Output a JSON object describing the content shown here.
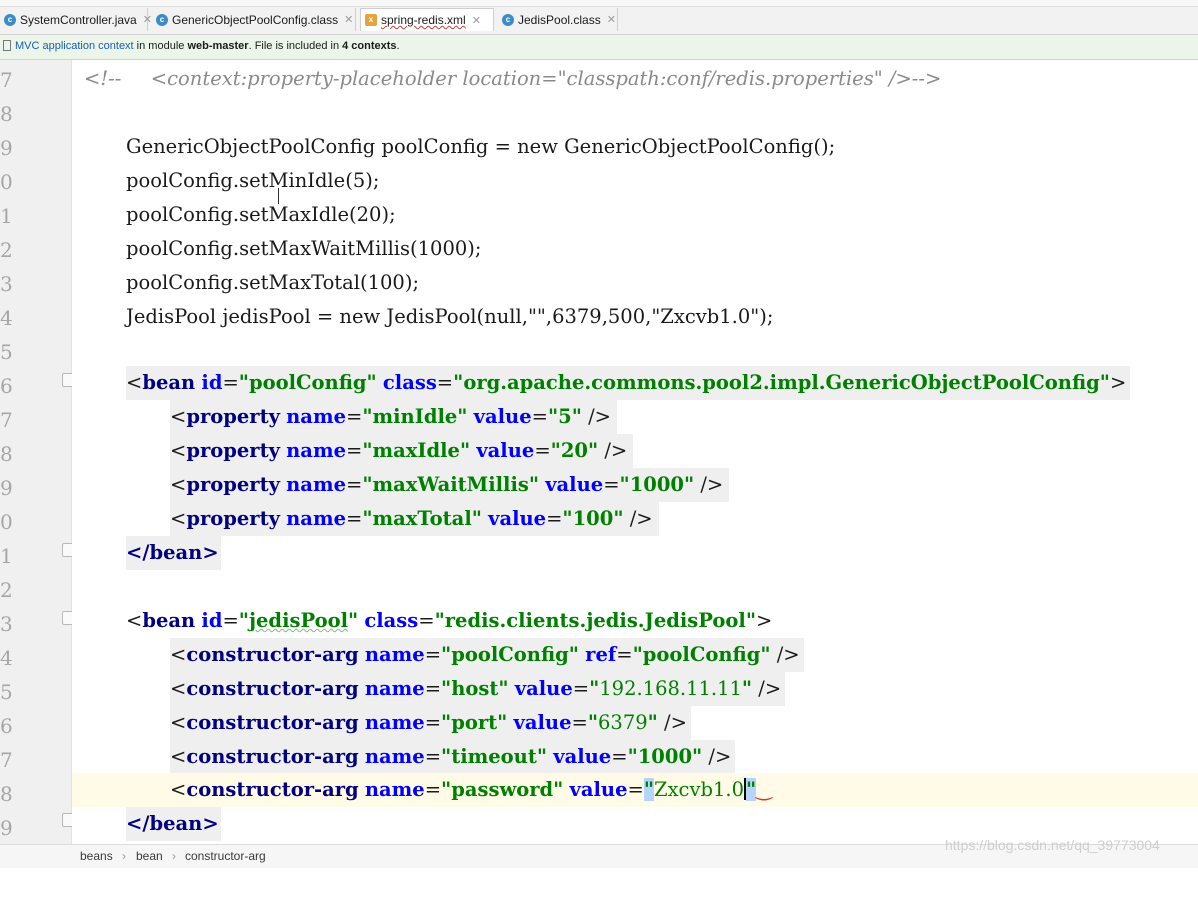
{
  "tabs": [
    {
      "label": "SystemController.java",
      "icon": "java-class-icon",
      "active": false
    },
    {
      "label": "GenericObjectPoolConfig.class",
      "icon": "class-file-icon",
      "active": false
    },
    {
      "label": "spring-redis.xml",
      "icon": "xml-file-icon",
      "active": true
    },
    {
      "label": "JedisPool.class",
      "icon": "class-file-icon",
      "active": false
    }
  ],
  "infobar": {
    "link": "MVC application context",
    "text1": " in module ",
    "module": "web-master",
    "text2": ". File is included in ",
    "contexts": "4 contexts",
    "text3": "."
  },
  "line_numbers": [
    "7",
    "8",
    "9",
    "0",
    "1",
    "2",
    "3",
    "4",
    "5",
    "6",
    "7",
    "8",
    "9",
    "0",
    "1",
    "2",
    "3",
    "4",
    "5",
    "6",
    "7",
    "8",
    "9"
  ],
  "code": {
    "l07": {
      "open": "<!--",
      "body": "    <context:property-placeholder location=\"classpath:conf/redis.properties\" />-->"
    },
    "l09": "GenericObjectPoolConfig poolConfig = new GenericObjectPoolConfig();",
    "l10": "poolConfig.setMinIdle(5);",
    "l11": "poolConfig.setMaxIdle(20);",
    "l12": "poolConfig.setMaxWaitMillis(1000);",
    "l13": "poolConfig.setMaxTotal(100);",
    "l14": "JedisPool jedisPool = new JedisPool(null,\"\",6379,500,\"Zxcvb1.0\");",
    "bean1": {
      "id": "poolConfig",
      "class": "org.apache.commons.pool2.impl.GenericObjectPoolConfig"
    },
    "props": [
      {
        "name": "minIdle",
        "value": "5"
      },
      {
        "name": "maxIdle",
        "value": "20"
      },
      {
        "name": "maxWaitMillis",
        "value": "1000"
      },
      {
        "name": "maxTotal",
        "value": "100"
      }
    ],
    "bean_close": "</bean>",
    "bean2": {
      "id": "jedisPool",
      "class": "redis.clients.jedis.JedisPool"
    },
    "args": [
      {
        "name": "poolConfig",
        "attr": "ref",
        "value": "poolConfig"
      },
      {
        "name": "host",
        "attr": "value",
        "value": "192.168.11.11"
      },
      {
        "name": "port",
        "attr": "value",
        "value": "6379"
      },
      {
        "name": "timeout",
        "attr": "value",
        "value": "1000"
      },
      {
        "name": "password",
        "attr": "value",
        "value": "Zxcvb1.0"
      }
    ]
  },
  "breadcrumb": [
    "beans",
    "bean",
    "constructor-arg"
  ],
  "watermark": "https://blog.csdn.net/qq_39773004",
  "colors": {
    "tag": "#000080",
    "attr": "#0000ff",
    "string": "#008000",
    "comment": "#8a8a8a"
  }
}
